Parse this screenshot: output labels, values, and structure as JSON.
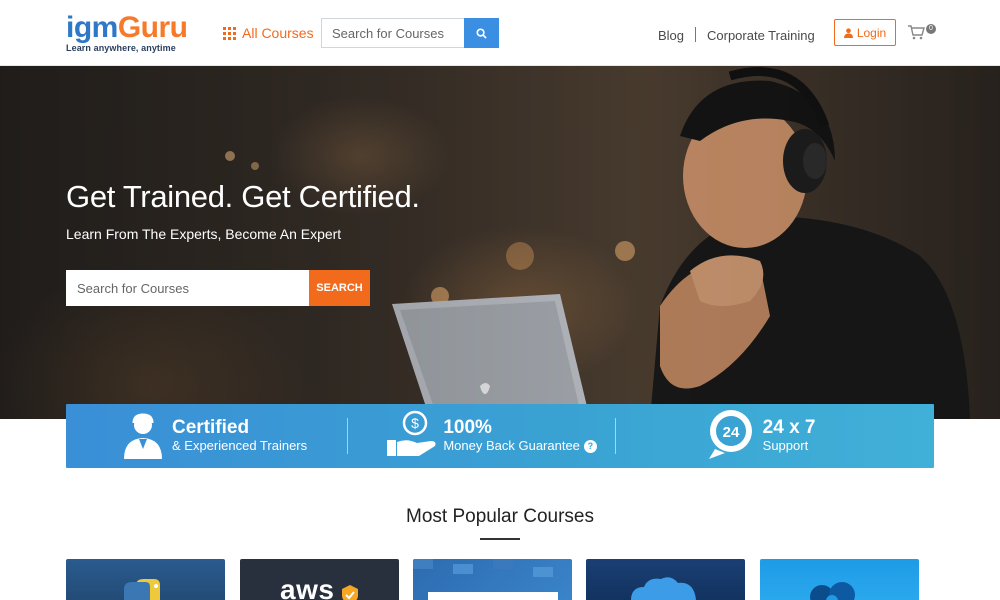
{
  "header": {
    "logo_part1": "igm",
    "logo_part2": "Guru",
    "logo_tagline": "Learn anywhere, anytime",
    "all_courses_label": "All Courses",
    "search_placeholder": "Search for Courses",
    "nav_blog": "Blog",
    "nav_corporate": "Corporate Training",
    "login_label": "Login",
    "cart_count": "0"
  },
  "hero": {
    "title": "Get Trained. Get Certified.",
    "subtitle": "Learn From The Experts, Become An Expert",
    "search_placeholder": "Search for Courses",
    "search_button": "SEARCH"
  },
  "features": [
    {
      "title": "Certified",
      "subtitle": "& Experienced Trainers",
      "icon": "trainer-icon"
    },
    {
      "title": "100%",
      "subtitle": "Money Back Guarantee",
      "icon": "money-back-icon"
    },
    {
      "title": "24 x 7",
      "subtitle": "Support",
      "icon": "support-24-icon",
      "icon_text": "24"
    }
  ],
  "popular": {
    "title": "Most Popular Courses",
    "cards": [
      {
        "name": "python-course-card"
      },
      {
        "name": "aws-course-card",
        "logo_text": "aws"
      },
      {
        "name": "course-card-3"
      },
      {
        "name": "cloud-course-card"
      },
      {
        "name": "course-card-5"
      }
    ]
  },
  "colors": {
    "brand_blue": "#2e78c7",
    "brand_orange": "#f26b1d",
    "search_blue": "#3b8fe3",
    "feature_bar": "#3aa3d3"
  }
}
